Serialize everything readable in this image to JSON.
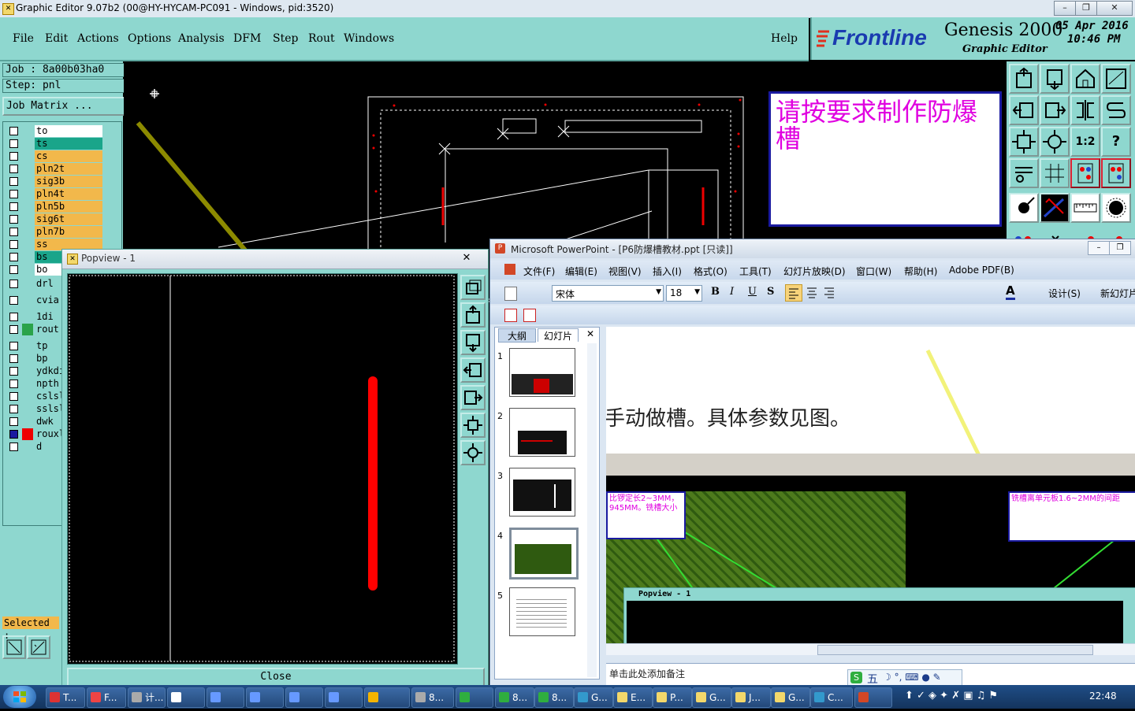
{
  "titlebar": {
    "title": "Graphic Editor 9.07b2 (00@HY-HYCAM-PC091 - Windows, pid:3520)",
    "minimize": "–",
    "restore": "❐",
    "close": "✕"
  },
  "menubar": {
    "items": [
      "File",
      "Edit",
      "Actions",
      "Options",
      "Analysis",
      "DFM",
      "Step",
      "Rout",
      "Windows"
    ],
    "help": "Help"
  },
  "brand": {
    "logo": "Frontline",
    "product": "Genesis 2000",
    "subtitle": "Graphic Editor",
    "date": "05 Apr 2016",
    "time": "10:46 PM"
  },
  "job": {
    "job_label": "Job : 8a00b03ha0",
    "step_label": "Step: pnl",
    "matrix_button": "Job Matrix ...",
    "selected_label": "Selected :"
  },
  "layers": [
    {
      "name": "to",
      "color": "#ffffff"
    },
    {
      "name": "ts",
      "color": "#1aa58a"
    },
    {
      "name": "cs",
      "color": "#f2b84b"
    },
    {
      "name": "pln2t",
      "color": "#f2b84b"
    },
    {
      "name": "sig3b",
      "color": "#f2b84b"
    },
    {
      "name": "pln4t",
      "color": "#f2b84b"
    },
    {
      "name": "pln5b",
      "color": "#f2b84b"
    },
    {
      "name": "sig6t",
      "color": "#f2b84b"
    },
    {
      "name": "pln7b",
      "color": "#f2b84b"
    },
    {
      "name": "ss",
      "color": "#f2b84b"
    },
    {
      "name": "bs",
      "color": "#1aa58a"
    },
    {
      "name": "bo",
      "color": "#ffffff"
    }
  ],
  "layers2": [
    {
      "name": "drl",
      "color": "#8ed7cf",
      "group": 1
    },
    {
      "name": "cvia",
      "color": "#8ed7cf",
      "group": 2
    },
    {
      "name": "1di",
      "color": "#8ed7cf",
      "group": 3
    },
    {
      "name": "rout",
      "color": "#8ed7cf",
      "group": 3
    },
    {
      "name": "tp",
      "color": "#8ed7cf",
      "group": 4
    },
    {
      "name": "bp",
      "color": "#8ed7cf",
      "group": 4
    },
    {
      "name": "ydkdi",
      "color": "#8ed7cf",
      "group": 4
    },
    {
      "name": "npth",
      "color": "#8ed7cf",
      "group": 4
    },
    {
      "name": "cslsl",
      "color": "#8ed7cf",
      "group": 4
    },
    {
      "name": "sslsl",
      "color": "#8ed7cf",
      "group": 4
    },
    {
      "name": "dwk",
      "color": "#8ed7cf",
      "group": 4
    },
    {
      "name": "rouxl",
      "color": "#8ed7cf",
      "group": 4
    },
    {
      "name": "d",
      "color": "#8ed7cf",
      "group": 4
    }
  ],
  "note_box": {
    "text": "请按要求制作防爆槽"
  },
  "tools": {
    "row3a": "1:2",
    "row3b": "?"
  },
  "popview": {
    "title": "Popview - 1",
    "close_x": "✕",
    "close_button": "Close"
  },
  "ppt": {
    "title": "Microsoft PowerPoint - [P6防爆槽教材.ppt [只读]]",
    "menus": [
      "文件(F)",
      "编辑(E)",
      "视图(V)",
      "插入(I)",
      "格式(O)",
      "工具(T)",
      "幻灯片放映(D)",
      "窗口(W)",
      "帮助(H)",
      "Adobe PDF(B)"
    ],
    "font": "宋体",
    "size": "18",
    "design": "设计(S)",
    "new_slide": "新幻灯片",
    "tabs": [
      "大纲",
      "幻灯片"
    ],
    "slides": [
      "1",
      "2",
      "3",
      "4",
      "5"
    ],
    "slide_text": "手动做槽。具体参数见图。",
    "callout_left": "比锣定长2~3MM，945MM。铣槽大小",
    "callout_right": "铣槽离单元板1.6~2MM的间距",
    "inner_popview": "Popview - 1",
    "notes": "单击此处添加备注"
  },
  "ime": {
    "label": "五"
  },
  "taskbar": {
    "items": [
      "T...",
      "F...",
      "计...",
      "",
      "",
      "",
      "",
      "",
      "",
      "8...",
      "",
      "8...",
      "8...",
      "G...",
      "E...",
      "P...",
      "G...",
      "J...",
      "G...",
      "C...",
      ""
    ],
    "clock": "22:48"
  },
  "colors": {
    "teal": "#8ed7cf",
    "red": "#ff0000",
    "magenta": "#e000e0",
    "olive": "#8c8a00",
    "yellow": "#f2f27a",
    "green": "#33dd33"
  }
}
